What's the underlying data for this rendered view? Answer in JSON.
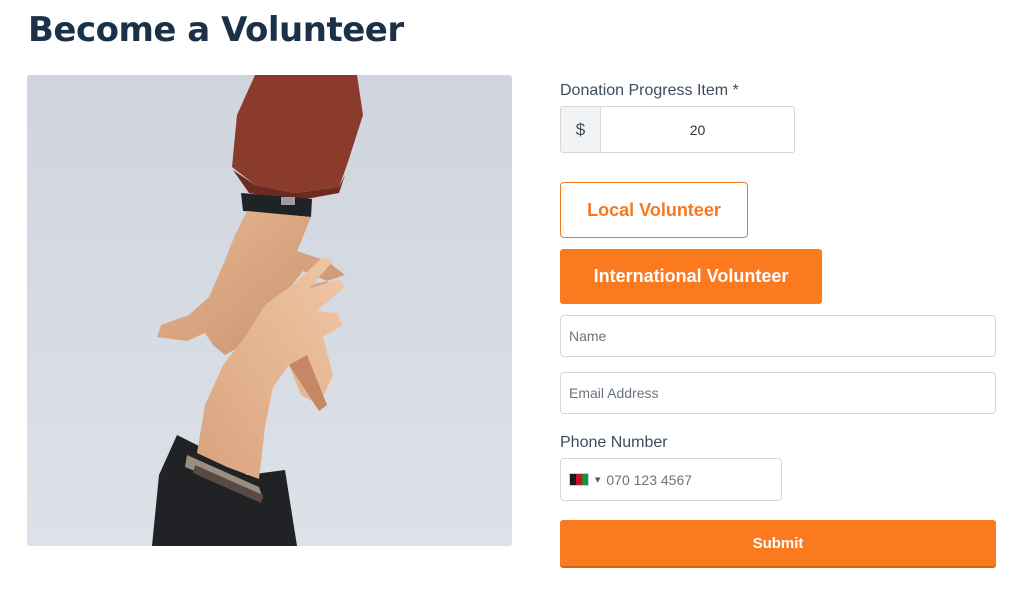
{
  "page": {
    "title": "Become a Volunteer"
  },
  "form": {
    "donation_label": "Donation Progress Item *",
    "currency_symbol": "$",
    "amount_value": "20",
    "local_volunteer_label": "Local Volunteer",
    "international_volunteer_label": "International Volunteer",
    "name_placeholder": "Name",
    "email_placeholder": "Email Address",
    "phone_label": "Phone Number",
    "phone_placeholder": "070 123 4567",
    "submit_label": "Submit"
  },
  "colors": {
    "accent": "#fb7a1f",
    "title": "#1b3147",
    "border": "#d5d9de"
  }
}
